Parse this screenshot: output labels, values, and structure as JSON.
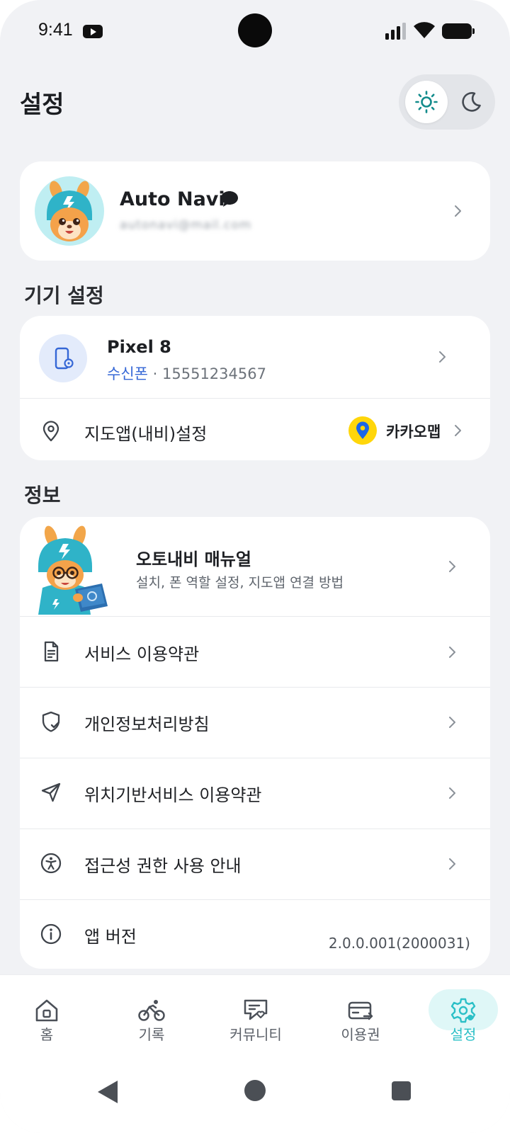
{
  "status_bar": {
    "time": "9:41"
  },
  "header": {
    "title": "설정"
  },
  "theme_toggle": {
    "light_icon": "sun-icon",
    "dark_icon": "moon-icon",
    "selected": "light"
  },
  "profile": {
    "name": "Auto Navi",
    "email": "autonavi@mail.com",
    "chevron": "chevron-right-icon"
  },
  "device_section": {
    "title": "기기 설정",
    "device": {
      "name": "Pixel 8",
      "role": "수신폰",
      "separator": " · ",
      "phone": "15551234567"
    },
    "map_setting": {
      "label": "지도앱(내비)설정",
      "value": "카카오맵"
    }
  },
  "info_section": {
    "title": "정보",
    "manual": {
      "title": "오토내비 매뉴얼",
      "description": "설치, 폰 역할 설정, 지도앱 연결 방법"
    },
    "items": [
      {
        "label": "서비스 이용약관",
        "icon": "document-icon"
      },
      {
        "label": "개인정보처리방침",
        "icon": "shield-check-icon"
      },
      {
        "label": "위치기반서비스 이용약관",
        "icon": "navigation-arrow-icon"
      },
      {
        "label": "접근성 권한 사용 안내",
        "icon": "accessibility-icon"
      }
    ],
    "version": {
      "label": "앱 버전",
      "value": "2.0.0.001(2000031)"
    }
  },
  "bottom_nav": {
    "items": [
      {
        "label": "홈",
        "icon": "home-icon"
      },
      {
        "label": "기록",
        "icon": "bike-icon"
      },
      {
        "label": "커뮤니티",
        "icon": "community-icon"
      },
      {
        "label": "이용권",
        "icon": "ticket-card-icon"
      },
      {
        "label": "설정",
        "icon": "settings-gear-icon"
      }
    ],
    "active_index": 4,
    "active_color": "#2cc0c7"
  },
  "colors": {
    "accent": "#2cc0c7",
    "link_blue": "#3567d6",
    "background": "#f1f2f5"
  }
}
